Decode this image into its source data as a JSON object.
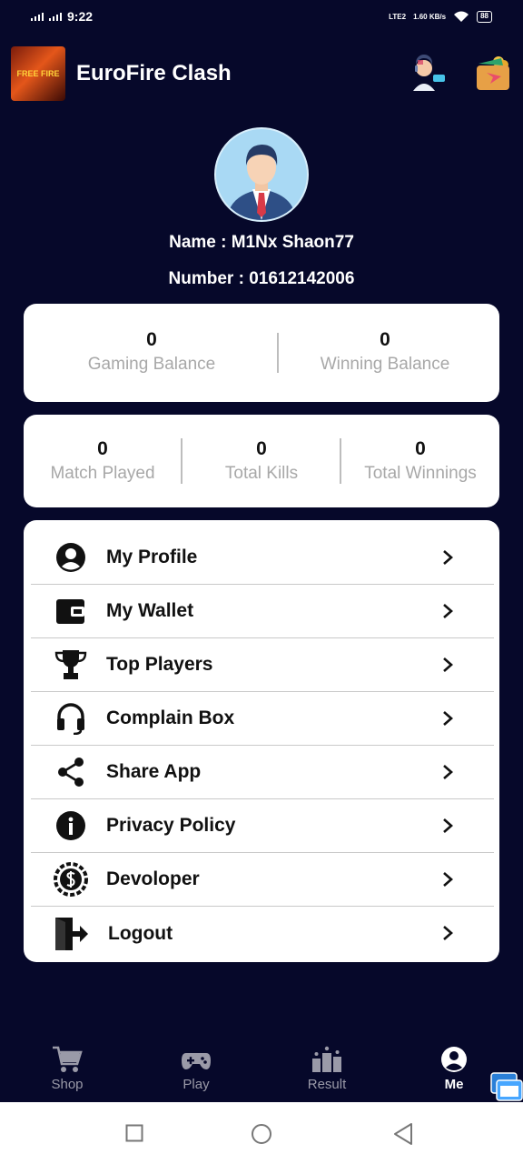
{
  "status_bar": {
    "time": "9:22",
    "network": "LTE2",
    "speed": "1.60 KB/s",
    "battery": "88"
  },
  "app": {
    "title": "EuroFire Clash",
    "logo_text": "FREE FIRE"
  },
  "icons": {
    "support": "support-agent-icon",
    "wallet": "wallet-icon"
  },
  "profile": {
    "name_line": "Name : M1Nx Shaon77",
    "number_line": "Number : 01612142006"
  },
  "balances": [
    {
      "value": "0",
      "label": "Gaming Balance"
    },
    {
      "value": "0",
      "label": "Winning Balance"
    }
  ],
  "stats": [
    {
      "value": "0",
      "label": "Match Played"
    },
    {
      "value": "0",
      "label": "Total Kills"
    },
    {
      "value": "0",
      "label": "Total Winnings"
    }
  ],
  "menu": [
    {
      "label": "My Profile",
      "icon": "account-circle-icon"
    },
    {
      "label": "My Wallet",
      "icon": "wallet-icon"
    },
    {
      "label": "Top Players",
      "icon": "trophy-icon"
    },
    {
      "label": "Complain Box",
      "icon": "headset-icon"
    },
    {
      "label": "Share App",
      "icon": "share-icon"
    },
    {
      "label": "Privacy Policy",
      "icon": "info-icon"
    },
    {
      "label": "Devoloper",
      "icon": "developer-badge-icon"
    },
    {
      "label": "Logout",
      "icon": "logout-icon"
    }
  ],
  "bottom_nav": [
    {
      "label": "Shop",
      "icon": "cart-icon",
      "active": false
    },
    {
      "label": "Play",
      "icon": "gamepad-icon",
      "active": false
    },
    {
      "label": "Result",
      "icon": "podium-icon",
      "active": false
    },
    {
      "label": "Me",
      "icon": "account-circle-icon",
      "active": true
    }
  ],
  "colors": {
    "background": "#06082a",
    "card": "#ffffff",
    "muted_text": "#a8a8a8",
    "inactive_nav": "#9a9aa8"
  }
}
